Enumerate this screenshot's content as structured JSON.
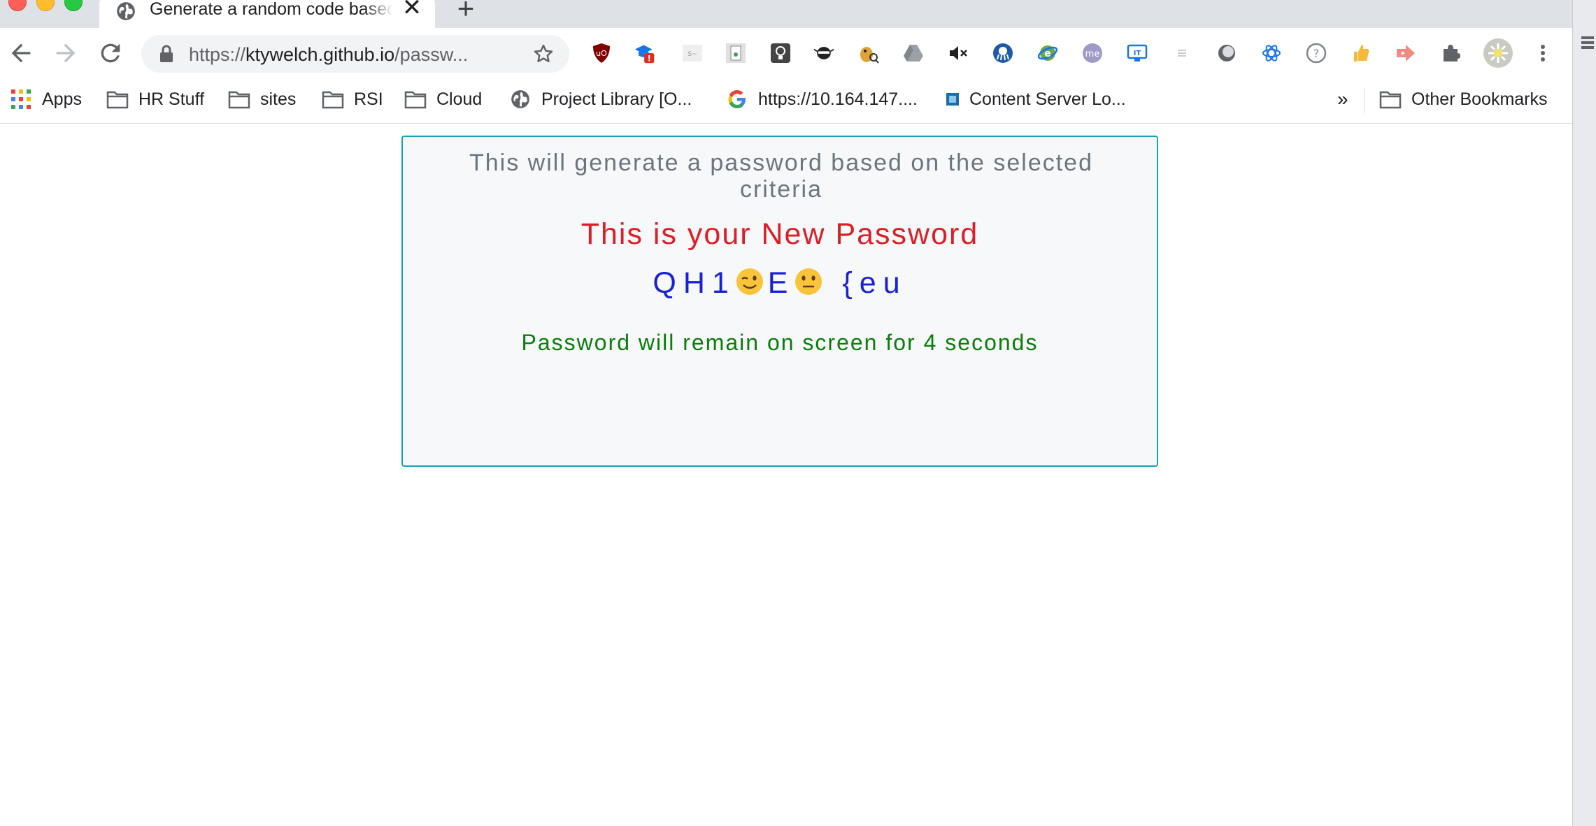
{
  "browser": {
    "tab": {
      "title": "Generate a random code based",
      "close_glyph": "✕",
      "icon": "globe-icon"
    },
    "new_tab_glyph": "+",
    "toolbar": {
      "back_icon": "back-arrow-icon",
      "forward_icon": "forward-arrow-icon",
      "reload_icon": "reload-icon",
      "url_scheme": "https://",
      "url_host": "ktywelch.github.io",
      "url_path": "/passw...",
      "bookmark_star_icon": "star-icon",
      "extensions": [
        "ublock-icon",
        "graduation-cap-icon",
        "sketch-icon",
        "sheets-icon",
        "lightbulb-icon",
        "ninja-icon",
        "bird-search-icon",
        "google-drive-icon",
        "mute-icon",
        "octopus-icon",
        "ie-tab-icon",
        "me-icon",
        "it-screen-icon",
        "list-icon",
        "circle-icon",
        "react-icon",
        "help-icon",
        "thumbs-up-icon",
        "arrow-icon",
        "puzzle-icon",
        "profile-avatar",
        "menu-kebab-icon"
      ]
    },
    "bookmarks": {
      "items": [
        {
          "label": "Apps",
          "icon": "apps-grid-icon"
        },
        {
          "label": "HR Stuff",
          "icon": "folder-icon"
        },
        {
          "label": "sites",
          "icon": "folder-icon"
        },
        {
          "label": "RSI",
          "icon": "folder-icon"
        },
        {
          "label": "Cloud",
          "icon": "folder-icon"
        },
        {
          "label": "Project Library [O...",
          "icon": "globe-icon"
        },
        {
          "label": "https://10.164.147....",
          "icon": "google-icon"
        },
        {
          "label": "Content Server Lo...",
          "icon": "content-server-icon"
        }
      ],
      "overflow": "»",
      "other": {
        "label": "Other Bookmarks",
        "icon": "folder-icon"
      }
    }
  },
  "page": {
    "intro": "This will generate a password based on the selected criteria",
    "heading": "This is your New Password",
    "password": {
      "before": "QH1",
      "middle": "E",
      "after": " {eu",
      "emojis": [
        "winking-face-emoji",
        "neutral-face-emoji"
      ]
    },
    "notice": "Password will remain on screen for 4 seconds"
  },
  "colors": {
    "card_border": "#17a2b8",
    "heading": "#dc1f26",
    "password": "#1a21d4",
    "notice": "#0a7d0a",
    "intro": "#6c757d"
  }
}
